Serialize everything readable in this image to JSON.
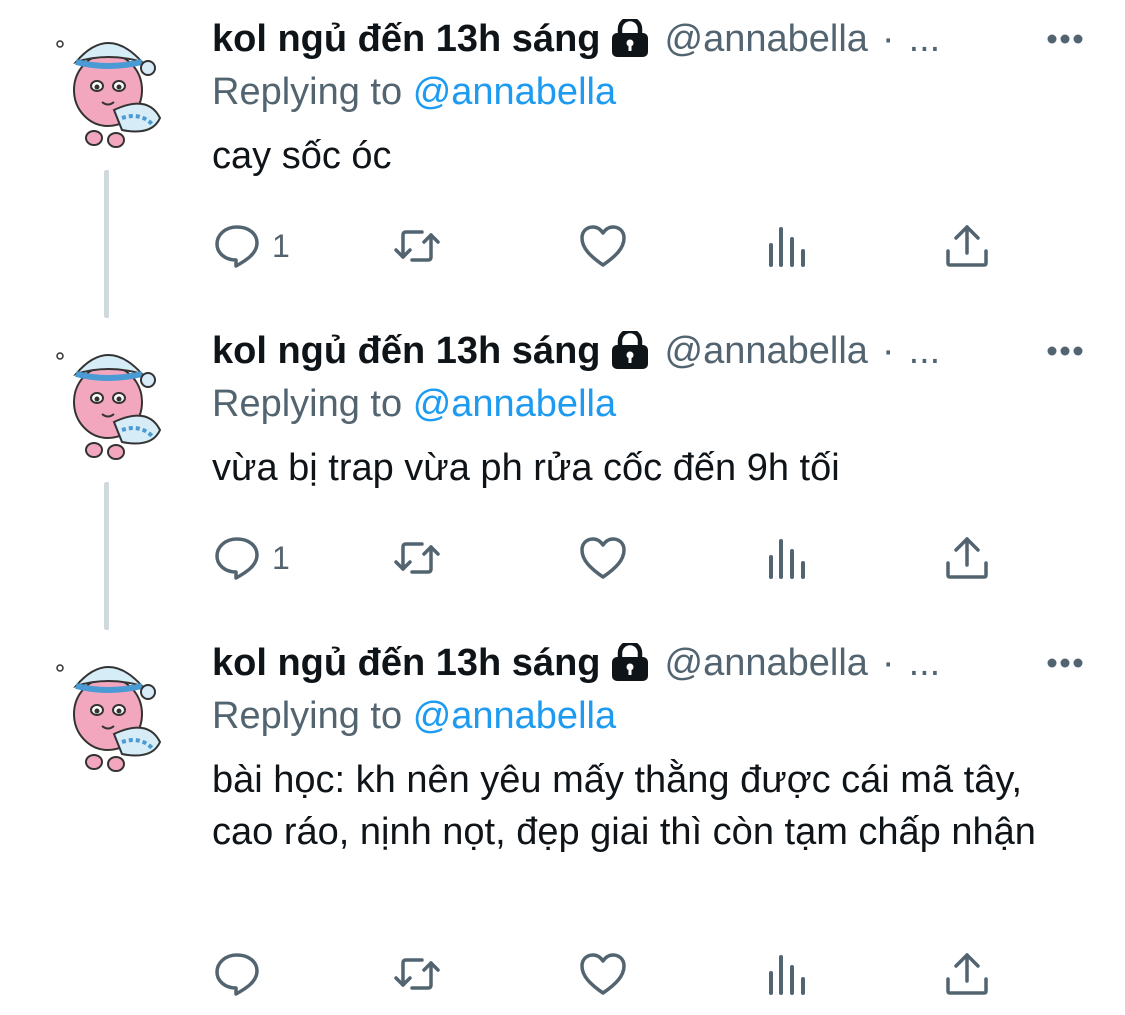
{
  "tweets": [
    {
      "display_name": "kol ngủ đến 13h sáng",
      "handle": "@annabella",
      "separator": "·",
      "time": "...",
      "replying_label": "Replying to",
      "replying_handle": "@annabella",
      "text": "cay sốc óc",
      "reply_count": "1",
      "icons": [
        "lock-icon",
        "more-icon",
        "reply-icon",
        "retweet-icon",
        "like-icon",
        "stats-icon",
        "share-icon"
      ]
    },
    {
      "display_name": "kol ngủ đến 13h sáng",
      "handle": "@annabella",
      "separator": "·",
      "time": "...",
      "replying_label": "Replying to",
      "replying_handle": "@annabella",
      "text": "vừa bị trap vừa ph rửa cốc đến 9h tối",
      "reply_count": "1",
      "icons": [
        "lock-icon",
        "more-icon",
        "reply-icon",
        "retweet-icon",
        "like-icon",
        "stats-icon",
        "share-icon"
      ]
    },
    {
      "display_name": "kol ngủ đến 13h sáng",
      "handle": "@annabella",
      "separator": "·",
      "time": "...",
      "replying_label": "Replying to",
      "replying_handle": "@annabella",
      "text": "bài học: kh nên yêu mấy thằng được cái mã tây, cao ráo, nịnh nọt, đẹp giai thì còn tạm chấp nhận",
      "reply_count": "",
      "icons": [
        "lock-icon",
        "more-icon",
        "reply-icon",
        "retweet-icon",
        "like-icon",
        "stats-icon",
        "share-icon"
      ]
    }
  ],
  "colors": {
    "text_primary": "#0f1419",
    "text_secondary": "#536471",
    "link": "#1d9bf0",
    "thread_line": "#cfd9de",
    "avatar_skin": "#f2a7bf",
    "avatar_hat": "#d6ecf7"
  }
}
